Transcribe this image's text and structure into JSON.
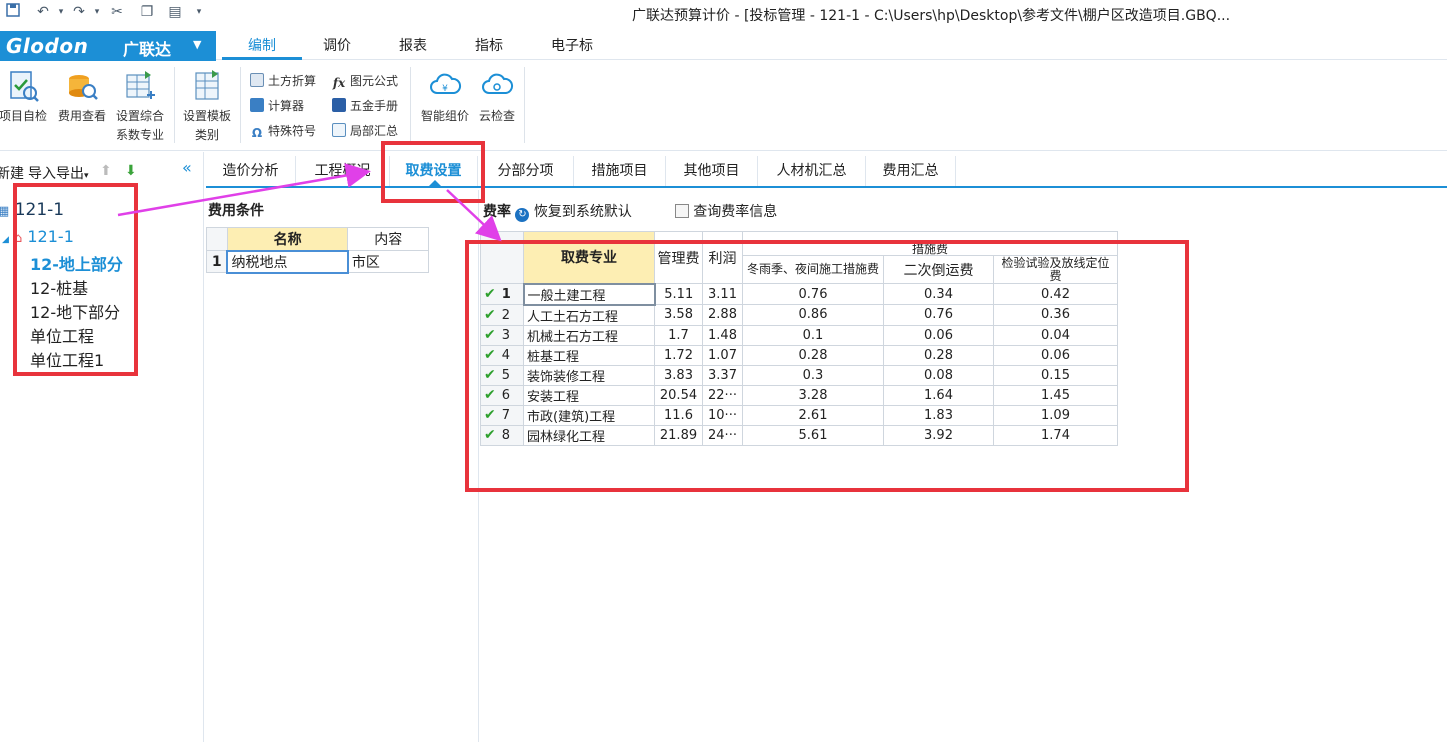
{
  "window": {
    "title": "广联达预算计价 - [投标管理 - 121-1 - C:\\Users\\hp\\Desktop\\参考文件\\棚户区改造项目.GBQ..."
  },
  "brand": {
    "logo": "Glodon",
    "logo_cn": "广联达"
  },
  "menu": {
    "tabs": [
      "编制",
      "调价",
      "报表",
      "指标",
      "电子标"
    ],
    "active": "编制"
  },
  "ribbon": {
    "big": [
      "项目自检",
      "费用查看",
      "设置综合",
      "系数专业",
      "设置模板",
      "类别",
      "智能组价",
      "云检查"
    ],
    "small": [
      "土方折算",
      "计算器",
      "特殊符号",
      "图元公式",
      "五金手册",
      "局部汇总"
    ]
  },
  "left_panel": {
    "toolbar": {
      "new": "新建",
      "import_export": "导入导出"
    },
    "tree": [
      {
        "label": "121-1"
      },
      {
        "label": "121-1"
      },
      {
        "label": "12-地上部分"
      },
      {
        "label": "12-桩基"
      },
      {
        "label": "12-地下部分"
      },
      {
        "label": "单位工程"
      },
      {
        "label": "单位工程1"
      }
    ]
  },
  "sub_tabs": [
    "造价分析",
    "工程概况",
    "取费设置",
    "分部分项",
    "措施项目",
    "其他项目",
    "人材机汇总",
    "费用汇总"
  ],
  "fee_conditions": {
    "title": "费用条件",
    "headers": [
      "名称",
      "内容"
    ],
    "rows": [
      {
        "no": "1",
        "name": "纳税地点",
        "content": "市区"
      }
    ]
  },
  "fee_rates": {
    "title": "费率",
    "restore_default": "恢复到系统默认",
    "query_info": "查询费率信息",
    "headers": {
      "specialty": "取费专业",
      "mgmt": "管理费",
      "profit": "利润",
      "measure_group": "措施费",
      "winter": "冬雨季、夜间施工措施费",
      "secondary": "二次倒运费",
      "inspection": "检验试验及放线定位费"
    },
    "rows": [
      {
        "no": "1",
        "name": "一般土建工程",
        "mgmt": "5.11",
        "profit": "3.11",
        "winter": "0.76",
        "secondary": "0.34",
        "inspection": "0.42"
      },
      {
        "no": "2",
        "name": "人工土石方工程",
        "mgmt": "3.58",
        "profit": "2.88",
        "winter": "0.86",
        "secondary": "0.76",
        "inspection": "0.36"
      },
      {
        "no": "3",
        "name": "机械土石方工程",
        "mgmt": "1.7",
        "profit": "1.48",
        "winter": "0.1",
        "secondary": "0.06",
        "inspection": "0.04"
      },
      {
        "no": "4",
        "name": "桩基工程",
        "mgmt": "1.72",
        "profit": "1.07",
        "winter": "0.28",
        "secondary": "0.28",
        "inspection": "0.06"
      },
      {
        "no": "5",
        "name": "装饰装修工程",
        "mgmt": "3.83",
        "profit": "3.37",
        "winter": "0.3",
        "secondary": "0.08",
        "inspection": "0.15"
      },
      {
        "no": "6",
        "name": "安装工程",
        "mgmt": "20.54",
        "profit": "22···",
        "winter": "3.28",
        "secondary": "1.64",
        "inspection": "1.45"
      },
      {
        "no": "7",
        "name": "市政(建筑)工程",
        "mgmt": "11.6",
        "profit": "10···",
        "winter": "2.61",
        "secondary": "1.83",
        "inspection": "1.09"
      },
      {
        "no": "8",
        "name": "园林绿化工程",
        "mgmt": "21.89",
        "profit": "24···",
        "winter": "5.61",
        "secondary": "3.92",
        "inspection": "1.74"
      }
    ]
  },
  "colors": {
    "accent": "#1c8fd6",
    "annotation_red": "#e8333c",
    "annotation_arrow": "#e040e8",
    "header_yellow": "#fdeeb3"
  }
}
